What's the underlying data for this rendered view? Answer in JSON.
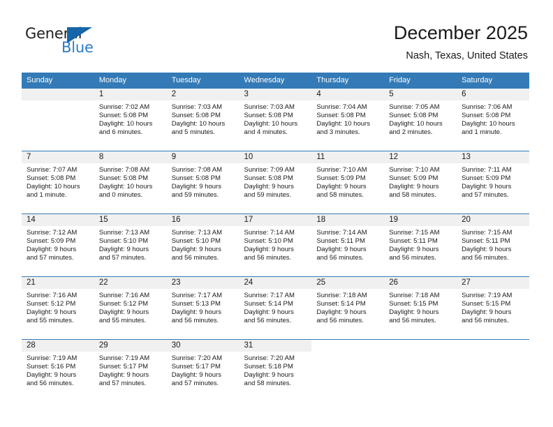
{
  "brand": {
    "name_top": "General",
    "name_bottom": "Blue",
    "triangle_color": "#1565a8",
    "blue_text_color": "#2b7cc2"
  },
  "header": {
    "month_title": "December 2025",
    "location": "Nash, Texas, United States",
    "header_bg": "#337ab7",
    "daynum_strip_bg": "#f0f0f0"
  },
  "weekday_headers": [
    "Sunday",
    "Monday",
    "Tuesday",
    "Wednesday",
    "Thursday",
    "Friday",
    "Saturday"
  ],
  "weeks": [
    [
      {
        "day": "",
        "empty": true,
        "lines": []
      },
      {
        "day": "1",
        "lines": [
          "Sunrise: 7:02 AM",
          "Sunset: 5:08 PM",
          "Daylight: 10 hours",
          "and 6 minutes."
        ]
      },
      {
        "day": "2",
        "lines": [
          "Sunrise: 7:03 AM",
          "Sunset: 5:08 PM",
          "Daylight: 10 hours",
          "and 5 minutes."
        ]
      },
      {
        "day": "3",
        "lines": [
          "Sunrise: 7:03 AM",
          "Sunset: 5:08 PM",
          "Daylight: 10 hours",
          "and 4 minutes."
        ]
      },
      {
        "day": "4",
        "lines": [
          "Sunrise: 7:04 AM",
          "Sunset: 5:08 PM",
          "Daylight: 10 hours",
          "and 3 minutes."
        ]
      },
      {
        "day": "5",
        "lines": [
          "Sunrise: 7:05 AM",
          "Sunset: 5:08 PM",
          "Daylight: 10 hours",
          "and 2 minutes."
        ]
      },
      {
        "day": "6",
        "lines": [
          "Sunrise: 7:06 AM",
          "Sunset: 5:08 PM",
          "Daylight: 10 hours",
          "and 1 minute."
        ]
      }
    ],
    [
      {
        "day": "7",
        "lines": [
          "Sunrise: 7:07 AM",
          "Sunset: 5:08 PM",
          "Daylight: 10 hours",
          "and 1 minute."
        ]
      },
      {
        "day": "8",
        "lines": [
          "Sunrise: 7:08 AM",
          "Sunset: 5:08 PM",
          "Daylight: 10 hours",
          "and 0 minutes."
        ]
      },
      {
        "day": "9",
        "lines": [
          "Sunrise: 7:08 AM",
          "Sunset: 5:08 PM",
          "Daylight: 9 hours",
          "and 59 minutes."
        ]
      },
      {
        "day": "10",
        "lines": [
          "Sunrise: 7:09 AM",
          "Sunset: 5:08 PM",
          "Daylight: 9 hours",
          "and 59 minutes."
        ]
      },
      {
        "day": "11",
        "lines": [
          "Sunrise: 7:10 AM",
          "Sunset: 5:09 PM",
          "Daylight: 9 hours",
          "and 58 minutes."
        ]
      },
      {
        "day": "12",
        "lines": [
          "Sunrise: 7:10 AM",
          "Sunset: 5:09 PM",
          "Daylight: 9 hours",
          "and 58 minutes."
        ]
      },
      {
        "day": "13",
        "lines": [
          "Sunrise: 7:11 AM",
          "Sunset: 5:09 PM",
          "Daylight: 9 hours",
          "and 57 minutes."
        ]
      }
    ],
    [
      {
        "day": "14",
        "lines": [
          "Sunrise: 7:12 AM",
          "Sunset: 5:09 PM",
          "Daylight: 9 hours",
          "and 57 minutes."
        ]
      },
      {
        "day": "15",
        "lines": [
          "Sunrise: 7:13 AM",
          "Sunset: 5:10 PM",
          "Daylight: 9 hours",
          "and 57 minutes."
        ]
      },
      {
        "day": "16",
        "lines": [
          "Sunrise: 7:13 AM",
          "Sunset: 5:10 PM",
          "Daylight: 9 hours",
          "and 56 minutes."
        ]
      },
      {
        "day": "17",
        "lines": [
          "Sunrise: 7:14 AM",
          "Sunset: 5:10 PM",
          "Daylight: 9 hours",
          "and 56 minutes."
        ]
      },
      {
        "day": "18",
        "lines": [
          "Sunrise: 7:14 AM",
          "Sunset: 5:11 PM",
          "Daylight: 9 hours",
          "and 56 minutes."
        ]
      },
      {
        "day": "19",
        "lines": [
          "Sunrise: 7:15 AM",
          "Sunset: 5:11 PM",
          "Daylight: 9 hours",
          "and 56 minutes."
        ]
      },
      {
        "day": "20",
        "lines": [
          "Sunrise: 7:15 AM",
          "Sunset: 5:11 PM",
          "Daylight: 9 hours",
          "and 56 minutes."
        ]
      }
    ],
    [
      {
        "day": "21",
        "lines": [
          "Sunrise: 7:16 AM",
          "Sunset: 5:12 PM",
          "Daylight: 9 hours",
          "and 55 minutes."
        ]
      },
      {
        "day": "22",
        "lines": [
          "Sunrise: 7:16 AM",
          "Sunset: 5:12 PM",
          "Daylight: 9 hours",
          "and 55 minutes."
        ]
      },
      {
        "day": "23",
        "lines": [
          "Sunrise: 7:17 AM",
          "Sunset: 5:13 PM",
          "Daylight: 9 hours",
          "and 56 minutes."
        ]
      },
      {
        "day": "24",
        "lines": [
          "Sunrise: 7:17 AM",
          "Sunset: 5:14 PM",
          "Daylight: 9 hours",
          "and 56 minutes."
        ]
      },
      {
        "day": "25",
        "lines": [
          "Sunrise: 7:18 AM",
          "Sunset: 5:14 PM",
          "Daylight: 9 hours",
          "and 56 minutes."
        ]
      },
      {
        "day": "26",
        "lines": [
          "Sunrise: 7:18 AM",
          "Sunset: 5:15 PM",
          "Daylight: 9 hours",
          "and 56 minutes."
        ]
      },
      {
        "day": "27",
        "lines": [
          "Sunrise: 7:19 AM",
          "Sunset: 5:15 PM",
          "Daylight: 9 hours",
          "and 56 minutes."
        ]
      }
    ],
    [
      {
        "day": "28",
        "lines": [
          "Sunrise: 7:19 AM",
          "Sunset: 5:16 PM",
          "Daylight: 9 hours",
          "and 56 minutes."
        ]
      },
      {
        "day": "29",
        "lines": [
          "Sunrise: 7:19 AM",
          "Sunset: 5:17 PM",
          "Daylight: 9 hours",
          "and 57 minutes."
        ]
      },
      {
        "day": "30",
        "lines": [
          "Sunrise: 7:20 AM",
          "Sunset: 5:17 PM",
          "Daylight: 9 hours",
          "and 57 minutes."
        ]
      },
      {
        "day": "31",
        "lines": [
          "Sunrise: 7:20 AM",
          "Sunset: 5:18 PM",
          "Daylight: 9 hours",
          "and 58 minutes."
        ]
      },
      {
        "day": "",
        "blank": true,
        "lines": []
      },
      {
        "day": "",
        "blank": true,
        "lines": []
      },
      {
        "day": "",
        "blank": true,
        "lines": []
      }
    ]
  ]
}
